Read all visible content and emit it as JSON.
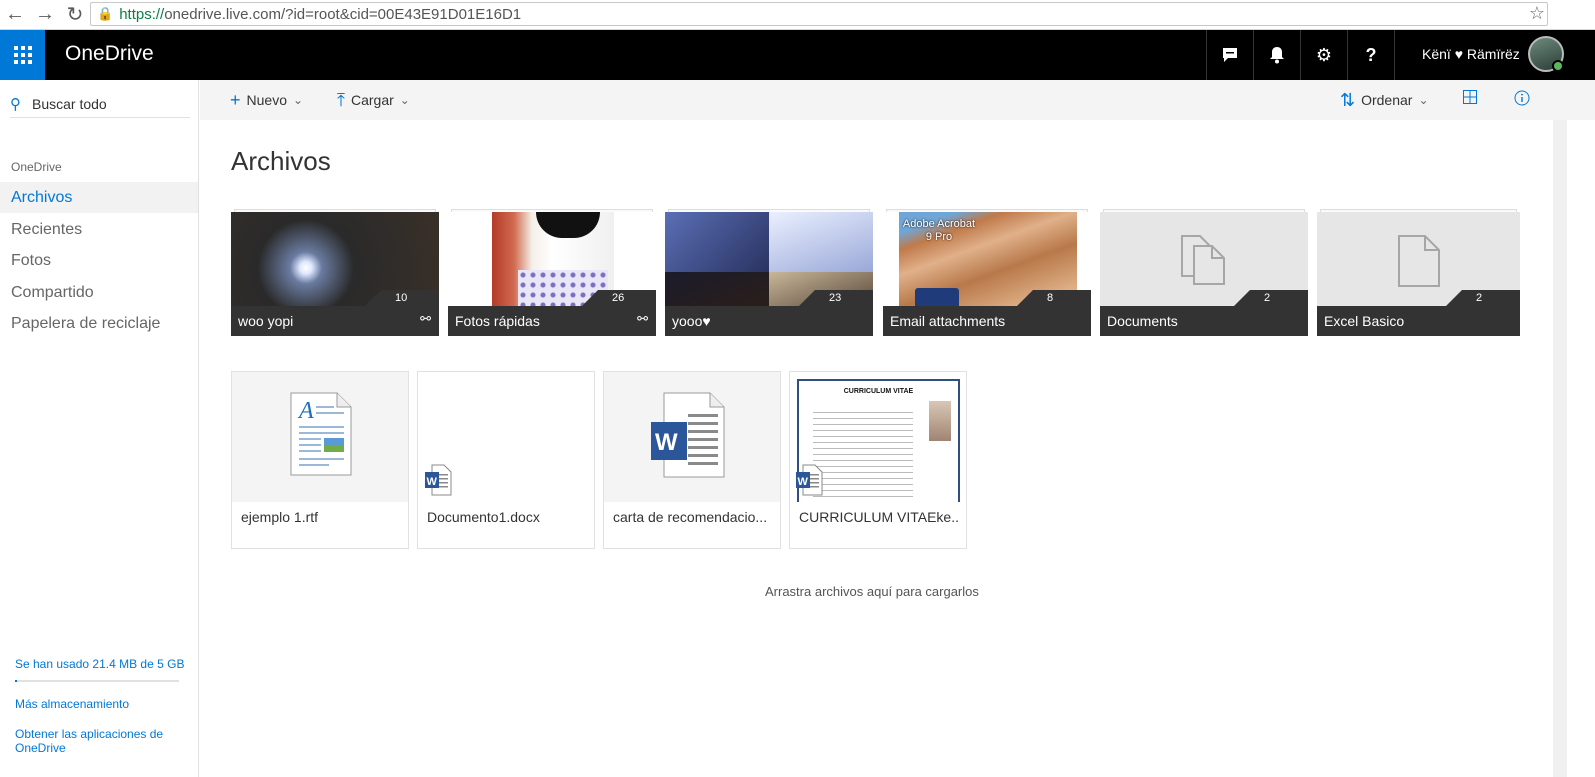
{
  "browser": {
    "url_scheme": "https://",
    "url_rest": "onedrive.live.com/?id=root&cid=00E43E91D01E16D1"
  },
  "suite": {
    "brand": "OneDrive",
    "user_name": "Kënï ♥ Rämïrëz"
  },
  "sidebar": {
    "search_label": "Buscar todo",
    "section_label": "OneDrive",
    "items": [
      {
        "label": "Archivos",
        "active": true
      },
      {
        "label": "Recientes",
        "active": false
      },
      {
        "label": "Fotos",
        "active": false
      },
      {
        "label": "Compartido",
        "active": false
      },
      {
        "label": "Papelera de reciclaje",
        "active": false
      }
    ],
    "storage_text": "Se han usado 21.4 MB de 5 GB",
    "storage_fraction": 0.004,
    "more_storage": "Más almacenamiento",
    "get_apps": "Obtener las aplicaciones de OneDrive"
  },
  "commands": {
    "new": "Nuevo",
    "upload": "Cargar",
    "sort": "Ordenar"
  },
  "main": {
    "title": "Archivos",
    "folders": [
      {
        "name": "woo yopi",
        "count": "10",
        "shared": true
      },
      {
        "name": "Fotos rápidas",
        "count": "26",
        "shared": true
      },
      {
        "name": "yooo♥",
        "count": "23",
        "shared": false
      },
      {
        "name": "Email attachments",
        "count": "8",
        "shared": false
      },
      {
        "name": "Documents",
        "count": "2",
        "shared": false
      },
      {
        "name": "Excel Basico",
        "count": "2",
        "shared": false
      }
    ],
    "folder_overlay_text": "Adobe Acrobat 9 Pro",
    "files": [
      {
        "name": "ejemplo 1.rtf"
      },
      {
        "name": "Documento1.docx"
      },
      {
        "name": "carta de recomendacio..."
      },
      {
        "name": "CURRICULUM VITAEke..."
      }
    ],
    "cv_heading": "CURRICULUM VITAE",
    "drop_hint": "Arrastra archivos aquí para cargarlos"
  },
  "colors": {
    "accent": "#0078d7",
    "suite_bar": "#000000",
    "folder_label": "#333333"
  }
}
